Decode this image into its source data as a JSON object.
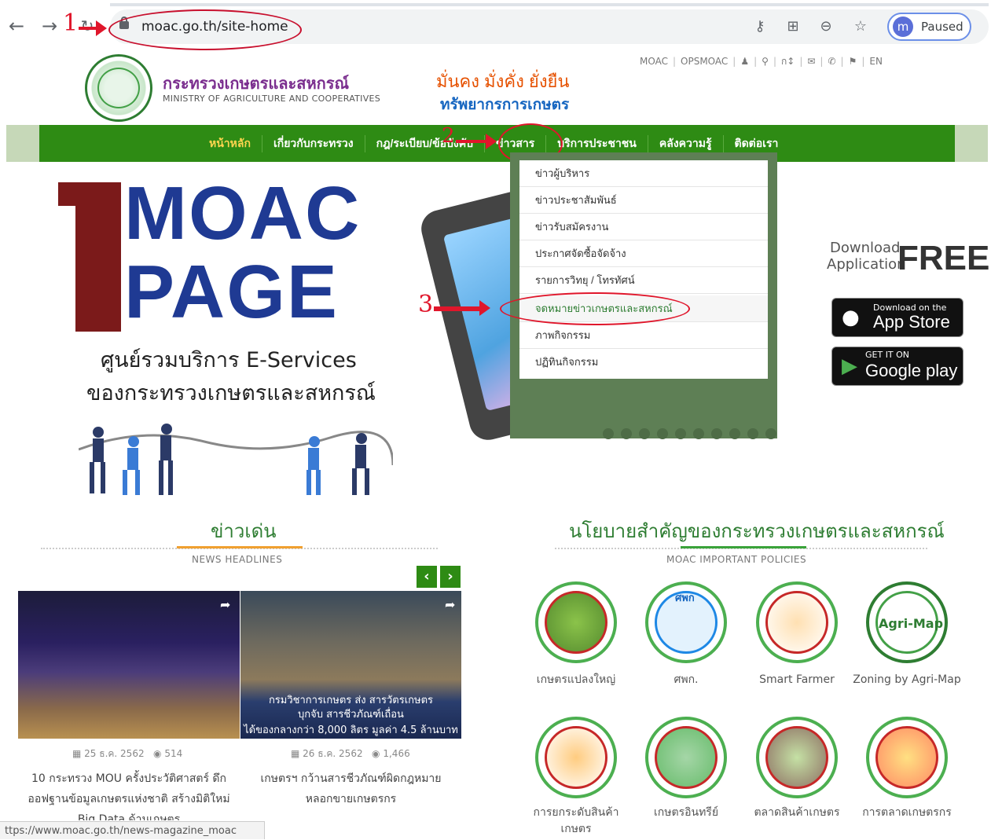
{
  "browser": {
    "url": "moac.go.th/site-home",
    "profile_initial": "m",
    "profile_status": "Paused",
    "status_url": "ttps://www.moac.go.th/news-magazine_moac"
  },
  "annotations": {
    "step1": "1",
    "step2": "2",
    "step3": "3"
  },
  "header": {
    "ministry_th": "กระทรวงเกษตรและสหกรณ์",
    "ministry_en": "MINISTRY OF AGRICULTURE AND COOPERATIVES",
    "slogan_line1": "มั่นคง มั่งคั่ง ยั่งยืน",
    "slogan_line2": "ทรัพยากรการเกษตร",
    "top_links": [
      "MOAC",
      "OPSMOAC",
      "ก",
      "EN"
    ]
  },
  "nav": [
    "หน้าหลัก",
    "เกี่ยวกับกระทรวง",
    "กฎ/ระเบียบ/ข้อบังคับ",
    "ข่าวสาร",
    "บริการประชาชน",
    "คลังความรู้",
    "ติดต่อเรา"
  ],
  "dropdown": [
    "ข่าวผู้บริหาร",
    "ข่าวประชาสัมพันธ์",
    "ข่าวรับสมัครงาน",
    "ประกาศจัดซื้อจัดจ้าง",
    "รายการวิทยุ / โทรทัศน์",
    "จดหมายข่าวเกษตรและสหกรณ์",
    "ภาพกิจกรรม",
    "ปฏิทินกิจกรรม"
  ],
  "banner": {
    "number": "1",
    "word1": "MOAC",
    "word2": "PAGE",
    "tagline1": "ศูนย์รวมบริการ E-Services",
    "tagline2": "ของกระทรวงเกษตรและสหกรณ์",
    "download_line1": "Download",
    "download_line2": "Application",
    "free": "FREE",
    "appstore_small": "Download on the",
    "appstore_big": "App Store",
    "gplay_small": "GET IT ON",
    "gplay_big": "Google play"
  },
  "news": {
    "title": "ข่าวเด่น",
    "subtitle": "NEWS HEADLINES",
    "image2_caption": [
      "กรมวิชาการเกษตร ส่ง สารวัตรเกษตร",
      "บุกจับ สารชีวภัณฑ์เถื่อน",
      "ได้ของกลางกว่า 8,000 ลิตร มูลค่า 4.5 ล้านบาท"
    ],
    "items": [
      {
        "date": "25 ธ.ค. 2562",
        "views": "514",
        "title_line1": "10 กระทรวง MOU ครั้งประวัติศาสตร์ ดึก",
        "title_line2": "ออฟฐานข้อมูลเกษตรแห่งชาติ สร้างมิติใหม่",
        "title_line3": "Big Data ด้านเกษตร"
      },
      {
        "date": "26 ธ.ค. 2562",
        "views": "1,466",
        "title_line1": "เกษตรฯ กว้านสารชีวภัณฑ์ผิดกฎหมาย",
        "title_line2": "หลอกขายเกษตรกร"
      }
    ]
  },
  "policies": {
    "title": "นโยบายสำคัญของกระทรวงเกษตรและสหกรณ์",
    "subtitle": "MOAC IMPORTANT POLICIES",
    "items": [
      {
        "label": "เกษตรแปลงใหญ่",
        "badge": ""
      },
      {
        "label": "ศพก.",
        "badge": "ศพก"
      },
      {
        "label": "Smart Farmer",
        "badge": ""
      },
      {
        "label": "Zoning by Agri-Map",
        "badge": "Agri-Map"
      },
      {
        "label": "การยกระดับสินค้าเกษตร",
        "badge": ""
      },
      {
        "label": "เกษตรอินทรีย์",
        "badge": ""
      },
      {
        "label": "ตลาดสินค้าเกษตร",
        "badge": ""
      },
      {
        "label": "การตลาดเกษตรกร",
        "badge": ""
      }
    ]
  }
}
